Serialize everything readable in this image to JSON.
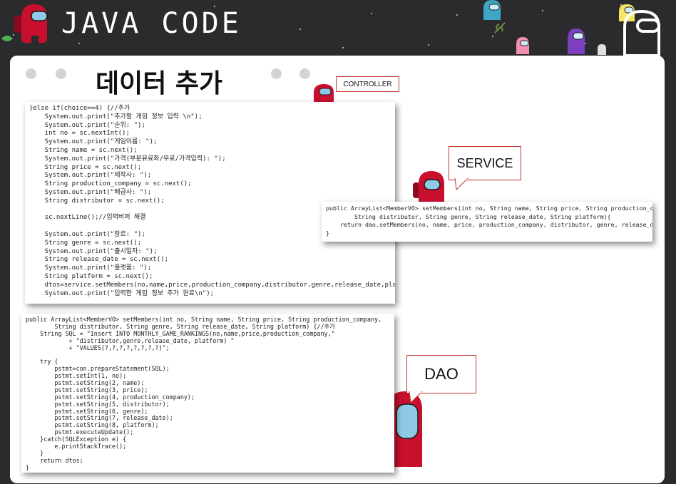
{
  "header": {
    "title": "JAVA CODE"
  },
  "slide": {
    "title": "데이터 추가"
  },
  "labels": {
    "controller": "CONTROLLER",
    "service": "SERVICE",
    "dao": "DAO"
  },
  "code": {
    "controller": [
      "}else if(choice==4) {//추가",
      "    System.out.print(\"추가할 게임 정보 입력 \\n\");",
      "    System.out.print(\"순위: \");",
      "    int no = sc.nextInt();",
      "    System.out.print(\"게임이름: \");",
      "    String name = sc.next();",
      "    System.out.print(\"가격(부분유료화/무료/가격입력): \");",
      "    String price = sc.next();",
      "    System.out.print(\"제작사: \");",
      "    String production_company = sc.next();",
      "    System.out.print(\"배급사: \");",
      "    String distributor = sc.next();",
      "",
      "    sc.nextLine();//입력버퍼 해결",
      "",
      "    System.out.print(\"장르: \");",
      "    String genre = sc.next();",
      "    System.out.print(\"출시일자: \");",
      "    String release_date = sc.next();",
      "    System.out.print(\"플랫폼: \");",
      "    String platform = sc.next();",
      "    dtos=service.setMembers(no,name,price,production_company,distributor,genre,release_date,platform);",
      "    System.out.print(\"입력한 게임 정보 추가 완료\\n\");"
    ],
    "service": [
      "public ArrayList<MemberVO> setMembers(int no, String name, String price, String production_company,",
      "        String distributor, String genre, String release_date, String platform){",
      "    return dao.setMembers(no, name, price, production_company, distributor, genre, release_date, platform);",
      "}"
    ],
    "dao": [
      "public ArrayList<MemberVO> setMembers(int no, String name, String price, String production_company,",
      "        String distributor, String genre, String release_date, String platform) {//추가",
      "    String SQL = \"Insert INTO MONTHLY_GAME_RANKINGS(no,name,price,production_company,\"",
      "            + \"distributor,genre,release_date, platform) \"",
      "            + \"VALUES(?,?,?,?,?,?,?,?)\";",
      "",
      "    try {",
      "        pstmt=con.prepareStatement(SQL);",
      "        pstmt.setInt(1, no);",
      "        pstmt.setString(2, name);",
      "        pstmt.setString(3, price);",
      "        pstmt.setString(4, production_company);",
      "        pstmt.setString(5, distributor);",
      "        pstmt.setString(6, genre);",
      "        pstmt.setString(7, release_date);",
      "        pstmt.setString(8, platform);",
      "        pstmt.executeUpdate();",
      "    }catch(SQLException e) {",
      "        e.printStackTrace();",
      "    }",
      "    return dtos;",
      "}"
    ]
  },
  "icons": [
    "crewmate-red-icon",
    "crewmate-cyan-icon",
    "crewmate-pink-icon",
    "crewmate-purple-icon",
    "crewmate-white-outline-icon",
    "leaf-icon"
  ],
  "colors": {
    "background": "#2b2b2e",
    "panel": "#ffffff",
    "crew_red": "#c8102e",
    "visor": "#8ecae6",
    "callout_border": "#c0392b"
  }
}
